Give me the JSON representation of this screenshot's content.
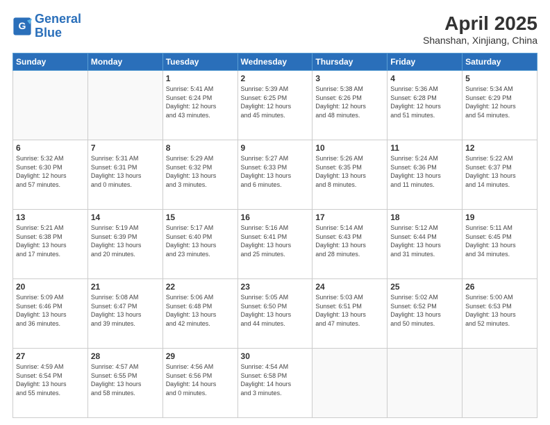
{
  "header": {
    "logo_line1": "General",
    "logo_line2": "Blue",
    "month_year": "April 2025",
    "location": "Shanshan, Xinjiang, China"
  },
  "days_of_week": [
    "Sunday",
    "Monday",
    "Tuesday",
    "Wednesday",
    "Thursday",
    "Friday",
    "Saturday"
  ],
  "weeks": [
    [
      {
        "day": "",
        "detail": ""
      },
      {
        "day": "",
        "detail": ""
      },
      {
        "day": "1",
        "detail": "Sunrise: 5:41 AM\nSunset: 6:24 PM\nDaylight: 12 hours\nand 43 minutes."
      },
      {
        "day": "2",
        "detail": "Sunrise: 5:39 AM\nSunset: 6:25 PM\nDaylight: 12 hours\nand 45 minutes."
      },
      {
        "day": "3",
        "detail": "Sunrise: 5:38 AM\nSunset: 6:26 PM\nDaylight: 12 hours\nand 48 minutes."
      },
      {
        "day": "4",
        "detail": "Sunrise: 5:36 AM\nSunset: 6:28 PM\nDaylight: 12 hours\nand 51 minutes."
      },
      {
        "day": "5",
        "detail": "Sunrise: 5:34 AM\nSunset: 6:29 PM\nDaylight: 12 hours\nand 54 minutes."
      }
    ],
    [
      {
        "day": "6",
        "detail": "Sunrise: 5:32 AM\nSunset: 6:30 PM\nDaylight: 12 hours\nand 57 minutes."
      },
      {
        "day": "7",
        "detail": "Sunrise: 5:31 AM\nSunset: 6:31 PM\nDaylight: 13 hours\nand 0 minutes."
      },
      {
        "day": "8",
        "detail": "Sunrise: 5:29 AM\nSunset: 6:32 PM\nDaylight: 13 hours\nand 3 minutes."
      },
      {
        "day": "9",
        "detail": "Sunrise: 5:27 AM\nSunset: 6:33 PM\nDaylight: 13 hours\nand 6 minutes."
      },
      {
        "day": "10",
        "detail": "Sunrise: 5:26 AM\nSunset: 6:35 PM\nDaylight: 13 hours\nand 8 minutes."
      },
      {
        "day": "11",
        "detail": "Sunrise: 5:24 AM\nSunset: 6:36 PM\nDaylight: 13 hours\nand 11 minutes."
      },
      {
        "day": "12",
        "detail": "Sunrise: 5:22 AM\nSunset: 6:37 PM\nDaylight: 13 hours\nand 14 minutes."
      }
    ],
    [
      {
        "day": "13",
        "detail": "Sunrise: 5:21 AM\nSunset: 6:38 PM\nDaylight: 13 hours\nand 17 minutes."
      },
      {
        "day": "14",
        "detail": "Sunrise: 5:19 AM\nSunset: 6:39 PM\nDaylight: 13 hours\nand 20 minutes."
      },
      {
        "day": "15",
        "detail": "Sunrise: 5:17 AM\nSunset: 6:40 PM\nDaylight: 13 hours\nand 23 minutes."
      },
      {
        "day": "16",
        "detail": "Sunrise: 5:16 AM\nSunset: 6:41 PM\nDaylight: 13 hours\nand 25 minutes."
      },
      {
        "day": "17",
        "detail": "Sunrise: 5:14 AM\nSunset: 6:43 PM\nDaylight: 13 hours\nand 28 minutes."
      },
      {
        "day": "18",
        "detail": "Sunrise: 5:12 AM\nSunset: 6:44 PM\nDaylight: 13 hours\nand 31 minutes."
      },
      {
        "day": "19",
        "detail": "Sunrise: 5:11 AM\nSunset: 6:45 PM\nDaylight: 13 hours\nand 34 minutes."
      }
    ],
    [
      {
        "day": "20",
        "detail": "Sunrise: 5:09 AM\nSunset: 6:46 PM\nDaylight: 13 hours\nand 36 minutes."
      },
      {
        "day": "21",
        "detail": "Sunrise: 5:08 AM\nSunset: 6:47 PM\nDaylight: 13 hours\nand 39 minutes."
      },
      {
        "day": "22",
        "detail": "Sunrise: 5:06 AM\nSunset: 6:48 PM\nDaylight: 13 hours\nand 42 minutes."
      },
      {
        "day": "23",
        "detail": "Sunrise: 5:05 AM\nSunset: 6:50 PM\nDaylight: 13 hours\nand 44 minutes."
      },
      {
        "day": "24",
        "detail": "Sunrise: 5:03 AM\nSunset: 6:51 PM\nDaylight: 13 hours\nand 47 minutes."
      },
      {
        "day": "25",
        "detail": "Sunrise: 5:02 AM\nSunset: 6:52 PM\nDaylight: 13 hours\nand 50 minutes."
      },
      {
        "day": "26",
        "detail": "Sunrise: 5:00 AM\nSunset: 6:53 PM\nDaylight: 13 hours\nand 52 minutes."
      }
    ],
    [
      {
        "day": "27",
        "detail": "Sunrise: 4:59 AM\nSunset: 6:54 PM\nDaylight: 13 hours\nand 55 minutes."
      },
      {
        "day": "28",
        "detail": "Sunrise: 4:57 AM\nSunset: 6:55 PM\nDaylight: 13 hours\nand 58 minutes."
      },
      {
        "day": "29",
        "detail": "Sunrise: 4:56 AM\nSunset: 6:56 PM\nDaylight: 14 hours\nand 0 minutes."
      },
      {
        "day": "30",
        "detail": "Sunrise: 4:54 AM\nSunset: 6:58 PM\nDaylight: 14 hours\nand 3 minutes."
      },
      {
        "day": "",
        "detail": ""
      },
      {
        "day": "",
        "detail": ""
      },
      {
        "day": "",
        "detail": ""
      }
    ]
  ]
}
